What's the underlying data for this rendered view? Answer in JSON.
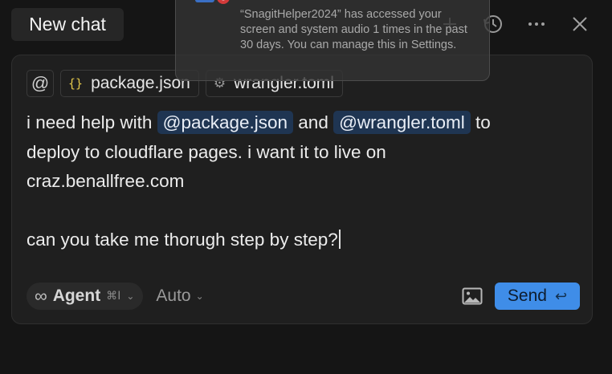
{
  "tab": {
    "title": "New chat"
  },
  "header_icons": [
    "plus-icon",
    "history-icon",
    "more-icon",
    "close-icon"
  ],
  "context": {
    "at_symbol": "@",
    "chips": [
      {
        "icon": "{}",
        "label": "package.json"
      },
      {
        "icon": "⚙",
        "label": "wrangler.toml"
      }
    ]
  },
  "message": {
    "line1_before": "i need help with ",
    "mention1": "@package.json",
    "line1_middle": " and ",
    "mention2": "@wrangler.toml",
    "line1_after": " to",
    "line2": "deploy to cloudflare pages. i want it to live on",
    "line3": "craz.benallfree.com",
    "line5": "can you take me thorugh step by step?"
  },
  "footer": {
    "agent_symbol": "∞",
    "agent_label": "Agent",
    "agent_shortcut": "⌘I",
    "chevron": "⌄",
    "model_label": "Auto",
    "send_label": "Send",
    "send_shortcut": "↩"
  },
  "notification": {
    "text": "“SnagitHelper2024” has accessed your screen and system audio 1 times in the past 30 days. You can manage this in Settings."
  },
  "colors": {
    "accent": "#3f8de8",
    "mention_bg": "#1f3552",
    "background": "#151515"
  }
}
